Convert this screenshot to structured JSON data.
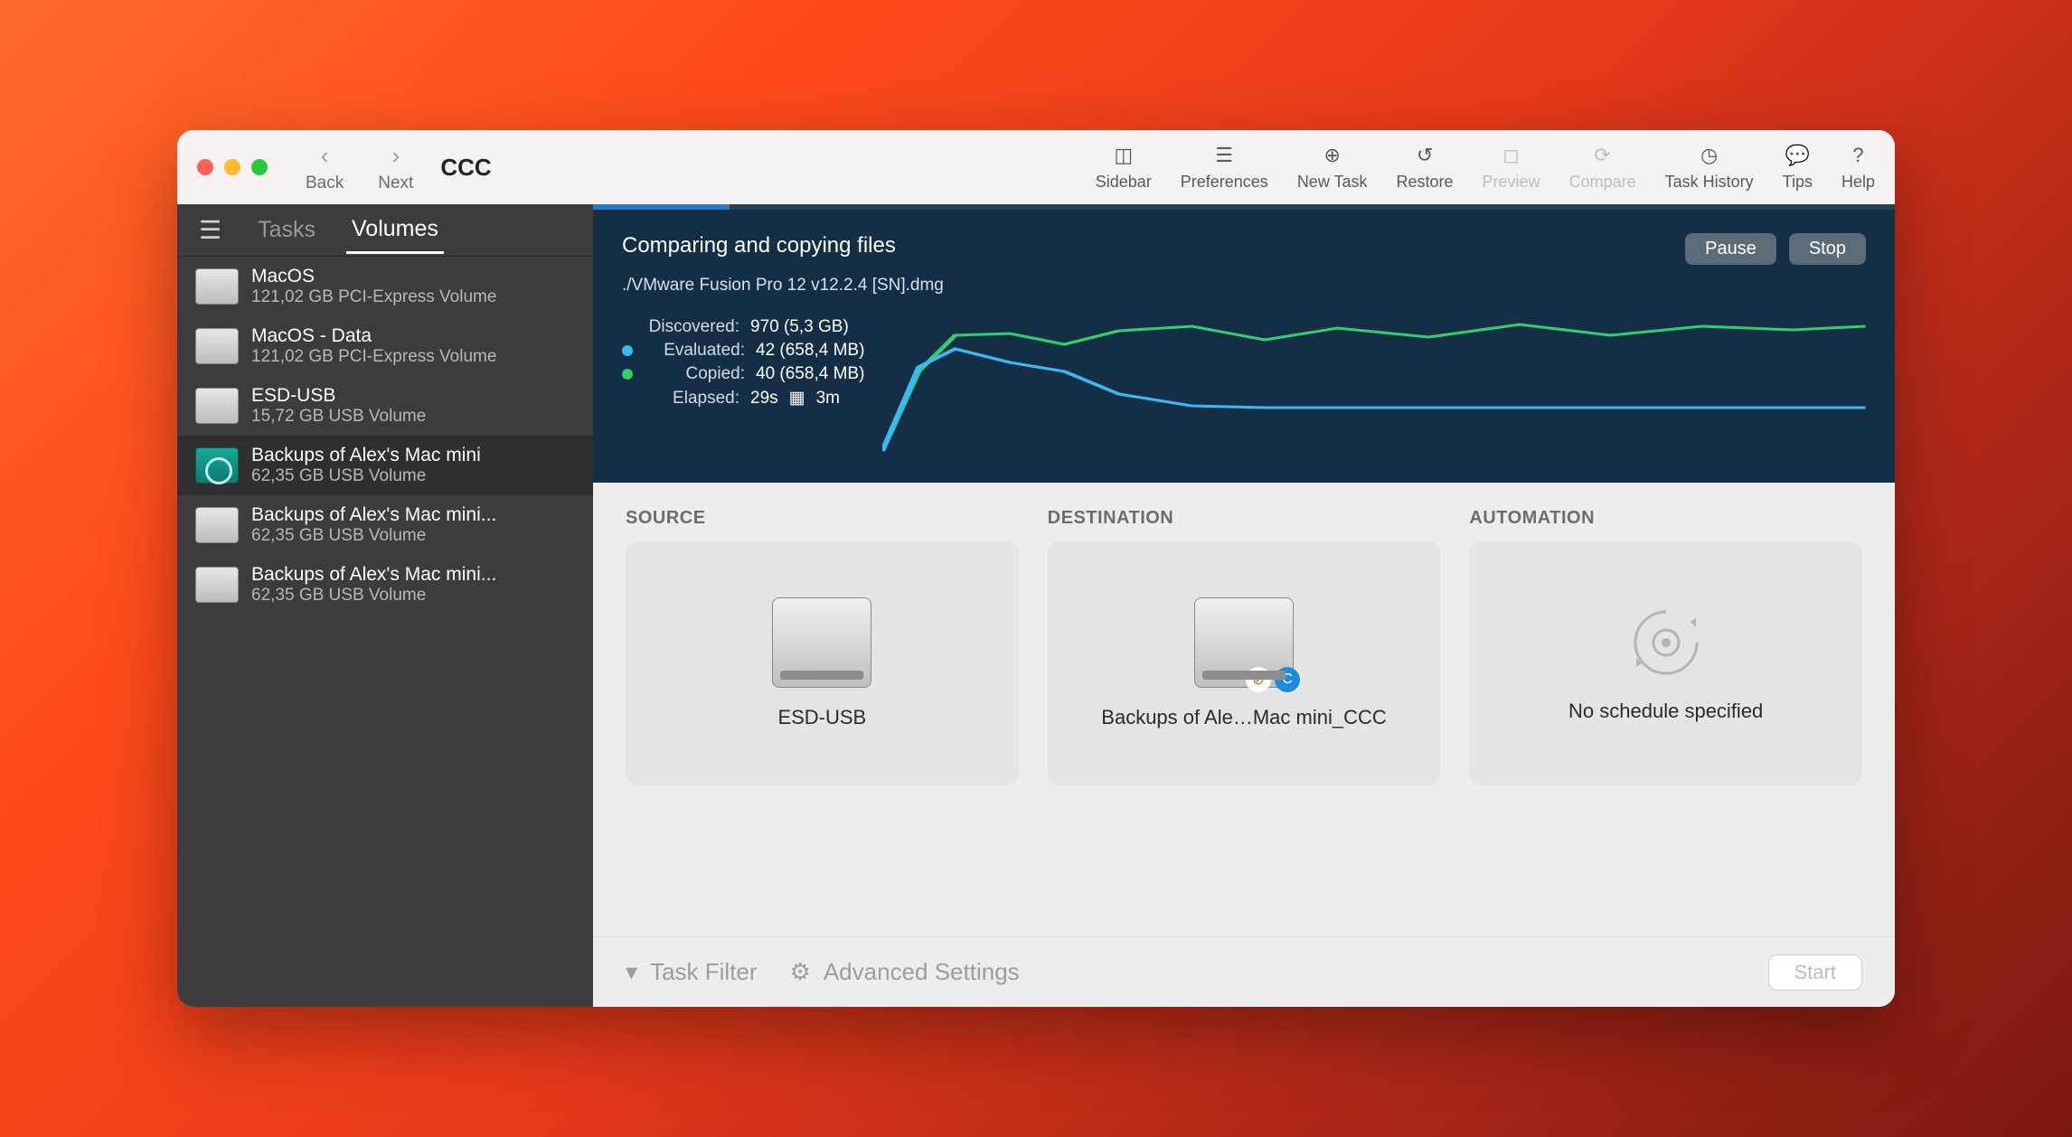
{
  "app": {
    "title": "CCC"
  },
  "nav": {
    "back": "Back",
    "next": "Next"
  },
  "toolbar": {
    "sidebar": "Sidebar",
    "preferences": "Preferences",
    "new_task": "New Task",
    "restore": "Restore",
    "preview": "Preview",
    "compare": "Compare",
    "task_history": "Task History",
    "tips": "Tips",
    "help": "Help"
  },
  "sidebar": {
    "tabs": {
      "tasks": "Tasks",
      "volumes": "Volumes"
    },
    "volumes": [
      {
        "name": "MacOS",
        "sub": "121,02 GB PCI-Express Volume"
      },
      {
        "name": "MacOS - Data",
        "sub": "121,02 GB PCI-Express Volume"
      },
      {
        "name": "ESD-USB",
        "sub": "15,72 GB USB Volume"
      },
      {
        "name": "Backups of Alex's Mac mini",
        "sub": "62,35 GB USB Volume"
      },
      {
        "name": "Backups of Alex's Mac mini...",
        "sub": "62,35 GB USB Volume"
      },
      {
        "name": "Backups of Alex's Mac mini...",
        "sub": "62,35 GB USB Volume"
      }
    ]
  },
  "progress": {
    "title": "Comparing and copying files",
    "current_file": "./VMware Fusion Pro 12 v12.2.4 [SN].dmg",
    "pause": "Pause",
    "stop": "Stop",
    "stats": {
      "discovered_k": "Discovered:",
      "discovered_v": "970 (5,3 GB)",
      "evaluated_k": "Evaluated:",
      "evaluated_v": "42 (658,4 MB)",
      "copied_k": "Copied:",
      "copied_v": "40 (658,4 MB)",
      "elapsed_k": "Elapsed:",
      "elapsed_v": "29s",
      "eta": "3m"
    }
  },
  "panels": {
    "source_h": "SOURCE",
    "source_name": "ESD-USB",
    "dest_h": "DESTINATION",
    "dest_name": "Backups of Ale…Mac mini_CCC",
    "auto_h": "AUTOMATION",
    "auto_text": "No schedule specified"
  },
  "footer": {
    "task_filter": "Task Filter",
    "advanced": "Advanced Settings",
    "start": "Start"
  }
}
